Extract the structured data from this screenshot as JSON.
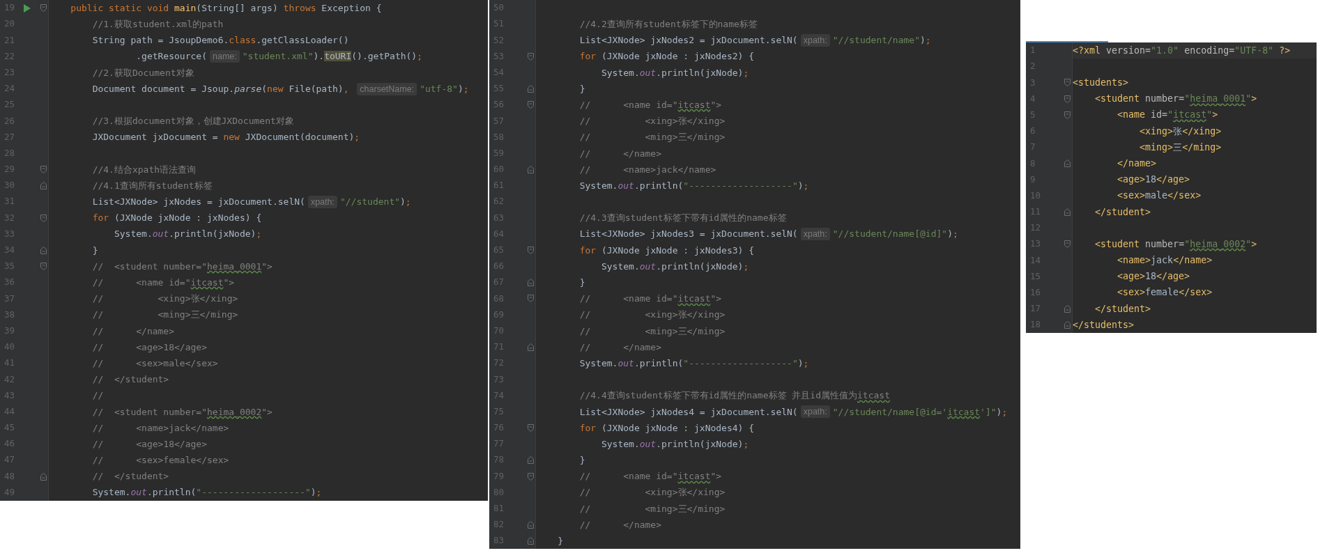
{
  "editors": [
    {
      "lines": [
        {
          "number": "19",
          "run": true,
          "fold": {
            "kind": "start"
          },
          "tokens": [
            {
              "text": "    public static void ",
              "kind": "keyword"
            },
            {
              "text": "main",
              "kind": "method"
            },
            {
              "text": "(String[] args) ",
              "kind": "plain"
            },
            {
              "text": "throws",
              "kind": "keyword"
            },
            {
              "text": " Exception {",
              "kind": "plain"
            }
          ]
        },
        {
          "number": "20",
          "tokens": [
            {
              "text": "        //1.获取student.xml的path",
              "kind": "comment"
            }
          ]
        },
        {
          "number": "21",
          "tokens": [
            {
              "text": "        String path = JsoupDemo6.",
              "kind": "plain"
            },
            {
              "text": "class",
              "kind": "keyword"
            },
            {
              "text": ".getClassLoader()",
              "kind": "plain"
            }
          ]
        },
        {
          "number": "22",
          "tokens": [
            {
              "text": "                .getResource(",
              "kind": "plain"
            },
            {
              "text": "name:",
              "kind": "hint"
            },
            {
              "text": "\"student.xml\"",
              "kind": "string"
            },
            {
              "text": ").",
              "kind": "plain"
            },
            {
              "text": "toURI",
              "kind": "highlight"
            },
            {
              "text": "().getPath()",
              "kind": "plain"
            },
            {
              "text": ";",
              "kind": "semi"
            }
          ]
        },
        {
          "number": "23",
          "tokens": [
            {
              "text": "        //2.获取Document对象",
              "kind": "comment"
            }
          ]
        },
        {
          "number": "24",
          "tokens": [
            {
              "text": "        Document document = Jsoup.",
              "kind": "plain"
            },
            {
              "text": "parse",
              "kind": "italic"
            },
            {
              "text": "(",
              "kind": "plain"
            },
            {
              "text": "new",
              "kind": "keyword"
            },
            {
              "text": " File(path)",
              "kind": "plain"
            },
            {
              "text": ", ",
              "kind": "semi"
            },
            {
              "text": "charsetName:",
              "kind": "hint"
            },
            {
              "text": "\"utf-8\"",
              "kind": "string"
            },
            {
              "text": ")",
              "kind": "plain"
            },
            {
              "text": ";",
              "kind": "semi"
            }
          ]
        },
        {
          "number": "25"
        },
        {
          "number": "26",
          "tokens": [
            {
              "text": "        //3.根据document对象，创建JXDocument对象",
              "kind": "comment"
            }
          ]
        },
        {
          "number": "27",
          "tokens": [
            {
              "text": "        JXDocument jxDocument = ",
              "kind": "plain"
            },
            {
              "text": "new",
              "kind": "keyword"
            },
            {
              "text": " JXDocument(document)",
              "kind": "plain"
            },
            {
              "text": ";",
              "kind": "semi"
            }
          ]
        },
        {
          "number": "28"
        },
        {
          "number": "29",
          "fold": {
            "kind": "start"
          },
          "tokens": [
            {
              "text": "        //4.结合xpath语法查询",
              "kind": "comment"
            }
          ]
        },
        {
          "number": "30",
          "fold": {
            "kind": "end"
          },
          "tokens": [
            {
              "text": "        //4.1查询所有student标签",
              "kind": "comment"
            }
          ]
        },
        {
          "number": "31",
          "tokens": [
            {
              "text": "        List<JXNode> jxNodes = jxDocument.selN(",
              "kind": "plain"
            },
            {
              "text": "xpath:",
              "kind": "hint"
            },
            {
              "text": "\"//student\"",
              "kind": "string"
            },
            {
              "text": ")",
              "kind": "plain"
            },
            {
              "text": ";",
              "kind": "semi"
            }
          ]
        },
        {
          "number": "32",
          "fold": {
            "kind": "start"
          },
          "tokens": [
            {
              "text": "        for",
              "kind": "keyword"
            },
            {
              "text": " (JXNode jxNode : jxNodes) {",
              "kind": "plain"
            }
          ]
        },
        {
          "number": "33",
          "tokens": [
            {
              "text": "            System.",
              "kind": "plain"
            },
            {
              "text": "out",
              "kind": "field"
            },
            {
              "text": ".println(jxNode)",
              "kind": "plain"
            },
            {
              "text": ";",
              "kind": "semi"
            }
          ]
        },
        {
          "number": "34",
          "fold": {
            "kind": "end"
          },
          "tokens": [
            {
              "text": "        }",
              "kind": "plain"
            }
          ]
        },
        {
          "number": "35",
          "fold": {
            "kind": "start"
          },
          "tokens": [
            {
              "text": "        //  <student number=\"",
              "kind": "comment"
            },
            {
              "text": "heima_0001",
              "kind": "typo_comment"
            },
            {
              "text": "\">",
              "kind": "comment"
            }
          ]
        },
        {
          "number": "36",
          "tokens": [
            {
              "text": "        //      <name id=\"",
              "kind": "comment"
            },
            {
              "text": "itcast",
              "kind": "typo_comment"
            },
            {
              "text": "\">",
              "kind": "comment"
            }
          ]
        },
        {
          "number": "37",
          "tokens": [
            {
              "text": "        //          <xing>张</xing>",
              "kind": "comment"
            }
          ]
        },
        {
          "number": "38",
          "tokens": [
            {
              "text": "        //          <ming>三</ming>",
              "kind": "comment"
            }
          ]
        },
        {
          "number": "39",
          "tokens": [
            {
              "text": "        //      </name>",
              "kind": "comment"
            }
          ]
        },
        {
          "number": "40",
          "tokens": [
            {
              "text": "        //      <age>18</age>",
              "kind": "comment"
            }
          ]
        },
        {
          "number": "41",
          "tokens": [
            {
              "text": "        //      <sex>male</sex>",
              "kind": "comment"
            }
          ]
        },
        {
          "number": "42",
          "tokens": [
            {
              "text": "        //  </student>",
              "kind": "comment"
            }
          ]
        },
        {
          "number": "43",
          "tokens": [
            {
              "text": "        //",
              "kind": "comment"
            }
          ]
        },
        {
          "number": "44",
          "tokens": [
            {
              "text": "        //  <student number=\"",
              "kind": "comment"
            },
            {
              "text": "heima_0002",
              "kind": "typo_comment"
            },
            {
              "text": "\">",
              "kind": "comment"
            }
          ]
        },
        {
          "number": "45",
          "tokens": [
            {
              "text": "        //      <name>jack</name>",
              "kind": "comment"
            }
          ]
        },
        {
          "number": "46",
          "tokens": [
            {
              "text": "        //      <age>18</age>",
              "kind": "comment"
            }
          ]
        },
        {
          "number": "47",
          "tokens": [
            {
              "text": "        //      <sex>female</sex>",
              "kind": "comment"
            }
          ]
        },
        {
          "number": "48",
          "fold": {
            "kind": "end"
          },
          "tokens": [
            {
              "text": "        //  </student>",
              "kind": "comment"
            }
          ]
        },
        {
          "number": "49",
          "tokens": [
            {
              "text": "        System.",
              "kind": "plain"
            },
            {
              "text": "out",
              "kind": "field"
            },
            {
              "text": ".println(",
              "kind": "plain"
            },
            {
              "text": "\"-------------------\"",
              "kind": "string"
            },
            {
              "text": ")",
              "kind": "plain"
            },
            {
              "text": ";",
              "kind": "semi"
            }
          ]
        }
      ]
    },
    {
      "lines": [
        {
          "number": "50"
        },
        {
          "number": "51",
          "tokens": [
            {
              "text": "        //4.2查询所有student标签下的name标签",
              "kind": "comment"
            }
          ]
        },
        {
          "number": "52",
          "tokens": [
            {
              "text": "        List<JXNode> jxNodes2 = jxDocument.selN(",
              "kind": "plain"
            },
            {
              "text": "xpath:",
              "kind": "hint"
            },
            {
              "text": "\"//student/name\"",
              "kind": "string"
            },
            {
              "text": ")",
              "kind": "plain"
            },
            {
              "text": ";",
              "kind": "semi"
            }
          ]
        },
        {
          "number": "53",
          "fold": {
            "kind": "start"
          },
          "tokens": [
            {
              "text": "        for",
              "kind": "keyword"
            },
            {
              "text": " (JXNode jxNode : jxNodes2) {",
              "kind": "plain"
            }
          ]
        },
        {
          "number": "54",
          "tokens": [
            {
              "text": "            System.",
              "kind": "plain"
            },
            {
              "text": "out",
              "kind": "field"
            },
            {
              "text": ".println(jxNode)",
              "kind": "plain"
            },
            {
              "text": ";",
              "kind": "semi"
            }
          ]
        },
        {
          "number": "55",
          "fold": {
            "kind": "end"
          },
          "tokens": [
            {
              "text": "        }",
              "kind": "plain"
            }
          ]
        },
        {
          "number": "56",
          "fold": {
            "kind": "start"
          },
          "tokens": [
            {
              "text": "        //      <name id=\"",
              "kind": "comment"
            },
            {
              "text": "itcast",
              "kind": "typo_comment"
            },
            {
              "text": "\">",
              "kind": "comment"
            }
          ]
        },
        {
          "number": "57",
          "tokens": [
            {
              "text": "        //          <xing>张</xing>",
              "kind": "comment"
            }
          ]
        },
        {
          "number": "58",
          "tokens": [
            {
              "text": "        //          <ming>三</ming>",
              "kind": "comment"
            }
          ]
        },
        {
          "number": "59",
          "tokens": [
            {
              "text": "        //      </name>",
              "kind": "comment"
            }
          ]
        },
        {
          "number": "60",
          "fold": {
            "kind": "end"
          },
          "tokens": [
            {
              "text": "        //      <name>jack</name>",
              "kind": "comment"
            }
          ]
        },
        {
          "number": "61",
          "tokens": [
            {
              "text": "        System.",
              "kind": "plain"
            },
            {
              "text": "out",
              "kind": "field"
            },
            {
              "text": ".println(",
              "kind": "plain"
            },
            {
              "text": "\"-------------------\"",
              "kind": "string"
            },
            {
              "text": ")",
              "kind": "plain"
            },
            {
              "text": ";",
              "kind": "semi"
            }
          ]
        },
        {
          "number": "62"
        },
        {
          "number": "63",
          "tokens": [
            {
              "text": "        //4.3查询student标签下带有id属性的name标签",
              "kind": "comment"
            }
          ]
        },
        {
          "number": "64",
          "tokens": [
            {
              "text": "        List<JXNode> jxNodes3 = jxDocument.selN(",
              "kind": "plain"
            },
            {
              "text": "xpath:",
              "kind": "hint"
            },
            {
              "text": "\"//student/name[@id]\"",
              "kind": "string"
            },
            {
              "text": ")",
              "kind": "plain"
            },
            {
              "text": ";",
              "kind": "semi"
            }
          ]
        },
        {
          "number": "65",
          "fold": {
            "kind": "start"
          },
          "tokens": [
            {
              "text": "        for",
              "kind": "keyword"
            },
            {
              "text": " (JXNode jxNode : jxNodes3) {",
              "kind": "plain"
            }
          ]
        },
        {
          "number": "66",
          "tokens": [
            {
              "text": "            System.",
              "kind": "plain"
            },
            {
              "text": "out",
              "kind": "field"
            },
            {
              "text": ".println(jxNode)",
              "kind": "plain"
            },
            {
              "text": ";",
              "kind": "semi"
            }
          ]
        },
        {
          "number": "67",
          "fold": {
            "kind": "end"
          },
          "tokens": [
            {
              "text": "        }",
              "kind": "plain"
            }
          ]
        },
        {
          "number": "68",
          "fold": {
            "kind": "start"
          },
          "tokens": [
            {
              "text": "        //      <name id=\"",
              "kind": "comment"
            },
            {
              "text": "itcast",
              "kind": "typo_comment"
            },
            {
              "text": "\">",
              "kind": "comment"
            }
          ]
        },
        {
          "number": "69",
          "tokens": [
            {
              "text": "        //          <xing>张</xing>",
              "kind": "comment"
            }
          ]
        },
        {
          "number": "70",
          "tokens": [
            {
              "text": "        //          <ming>三</ming>",
              "kind": "comment"
            }
          ]
        },
        {
          "number": "71",
          "fold": {
            "kind": "end"
          },
          "tokens": [
            {
              "text": "        //      </name>",
              "kind": "comment"
            }
          ]
        },
        {
          "number": "72",
          "tokens": [
            {
              "text": "        System.",
              "kind": "plain"
            },
            {
              "text": "out",
              "kind": "field"
            },
            {
              "text": ".println(",
              "kind": "plain"
            },
            {
              "text": "\"-------------------\"",
              "kind": "string"
            },
            {
              "text": ")",
              "kind": "plain"
            },
            {
              "text": ";",
              "kind": "semi"
            }
          ]
        },
        {
          "number": "73"
        },
        {
          "number": "74",
          "tokens": [
            {
              "text": "        //4.4查询student标签下带有id属性的name标签 并且id属性值为",
              "kind": "comment"
            },
            {
              "text": "itcast",
              "kind": "typo_comment"
            }
          ]
        },
        {
          "number": "75",
          "tokens": [
            {
              "text": "        List<JXNode> jxNodes4 = jxDocument.selN(",
              "kind": "plain"
            },
            {
              "text": "xpath:",
              "kind": "hint"
            },
            {
              "text": "\"//student/name[@id='",
              "kind": "string"
            },
            {
              "text": "itcast",
              "kind": "typo_string"
            },
            {
              "text": "']\"",
              "kind": "string"
            },
            {
              "text": ")",
              "kind": "plain"
            },
            {
              "text": ";",
              "kind": "semi"
            }
          ]
        },
        {
          "number": "76",
          "fold": {
            "kind": "start"
          },
          "tokens": [
            {
              "text": "        for",
              "kind": "keyword"
            },
            {
              "text": " (JXNode jxNode : jxNodes4) {",
              "kind": "plain"
            }
          ]
        },
        {
          "number": "77",
          "tokens": [
            {
              "text": "            System.",
              "kind": "plain"
            },
            {
              "text": "out",
              "kind": "field"
            },
            {
              "text": ".println(jxNode)",
              "kind": "plain"
            },
            {
              "text": ";",
              "kind": "semi"
            }
          ]
        },
        {
          "number": "78",
          "fold": {
            "kind": "end"
          },
          "tokens": [
            {
              "text": "        }",
              "kind": "plain"
            }
          ]
        },
        {
          "number": "79",
          "fold": {
            "kind": "start"
          },
          "tokens": [
            {
              "text": "        //      <name id=\"",
              "kind": "comment"
            },
            {
              "text": "itcast",
              "kind": "typo_comment"
            },
            {
              "text": "\">",
              "kind": "comment"
            }
          ]
        },
        {
          "number": "80",
          "tokens": [
            {
              "text": "        //          <xing>张</xing>",
              "kind": "comment"
            }
          ]
        },
        {
          "number": "81",
          "tokens": [
            {
              "text": "        //          <ming>三</ming>",
              "kind": "comment"
            }
          ]
        },
        {
          "number": "82",
          "fold": {
            "kind": "end"
          },
          "tokens": [
            {
              "text": "        //      </name>",
              "kind": "comment"
            }
          ]
        },
        {
          "number": "83",
          "fold": {
            "kind": "end"
          },
          "tokens": [
            {
              "text": "    }",
              "kind": "plain"
            }
          ]
        }
      ]
    },
    {
      "lines": [
        {
          "number": "1",
          "current": true,
          "tokens": [
            {
              "text": "<?xml ",
              "kind": "tag"
            },
            {
              "text": "version=",
              "kind": "attr"
            },
            {
              "text": "\"1.0\"",
              "kind": "string"
            },
            {
              "text": " encoding=",
              "kind": "attr"
            },
            {
              "text": "\"UTF-8\"",
              "kind": "string"
            },
            {
              "text": " ?>",
              "kind": "tag"
            }
          ]
        },
        {
          "number": "2"
        },
        {
          "number": "3",
          "fold": {
            "kind": "start"
          },
          "tokens": [
            {
              "text": "<students>",
              "kind": "tag"
            }
          ]
        },
        {
          "number": "4",
          "fold": {
            "kind": "start"
          },
          "tokens": [
            {
              "text": "    <student ",
              "kind": "tag"
            },
            {
              "text": "number=",
              "kind": "attr"
            },
            {
              "text": "\"",
              "kind": "string"
            },
            {
              "text": "heima_0001",
              "kind": "typo_string"
            },
            {
              "text": "\"",
              "kind": "string"
            },
            {
              "text": ">",
              "kind": "tag"
            }
          ]
        },
        {
          "number": "5",
          "fold": {
            "kind": "start"
          },
          "tokens": [
            {
              "text": "        <name ",
              "kind": "tag"
            },
            {
              "text": "id=",
              "kind": "attr"
            },
            {
              "text": "\"",
              "kind": "string"
            },
            {
              "text": "itcast",
              "kind": "typo_string"
            },
            {
              "text": "\"",
              "kind": "string"
            },
            {
              "text": ">",
              "kind": "tag"
            }
          ]
        },
        {
          "number": "6",
          "tokens": [
            {
              "text": "            <xing>",
              "kind": "tag"
            },
            {
              "text": "张",
              "kind": "plain"
            },
            {
              "text": "</xing>",
              "kind": "tag"
            }
          ]
        },
        {
          "number": "7",
          "tokens": [
            {
              "text": "            <ming>",
              "kind": "tag"
            },
            {
              "text": "三",
              "kind": "plain"
            },
            {
              "text": "</ming>",
              "kind": "tag"
            }
          ]
        },
        {
          "number": "8",
          "fold": {
            "kind": "end"
          },
          "tokens": [
            {
              "text": "        </name>",
              "kind": "tag"
            }
          ]
        },
        {
          "number": "9",
          "tokens": [
            {
              "text": "        <age>",
              "kind": "tag"
            },
            {
              "text": "18",
              "kind": "plain"
            },
            {
              "text": "</age>",
              "kind": "tag"
            }
          ]
        },
        {
          "number": "10",
          "tokens": [
            {
              "text": "        <sex>",
              "kind": "tag"
            },
            {
              "text": "male",
              "kind": "plain"
            },
            {
              "text": "</sex>",
              "kind": "tag"
            }
          ]
        },
        {
          "number": "11",
          "fold": {
            "kind": "end"
          },
          "tokens": [
            {
              "text": "    </student>",
              "kind": "tag"
            }
          ]
        },
        {
          "number": "12"
        },
        {
          "number": "13",
          "fold": {
            "kind": "start"
          },
          "tokens": [
            {
              "text": "    <student ",
              "kind": "tag"
            },
            {
              "text": "number=",
              "kind": "attr"
            },
            {
              "text": "\"",
              "kind": "string"
            },
            {
              "text": "heima_0002",
              "kind": "typo_string"
            },
            {
              "text": "\"",
              "kind": "string"
            },
            {
              "text": ">",
              "kind": "tag"
            }
          ]
        },
        {
          "number": "14",
          "tokens": [
            {
              "text": "        <name>",
              "kind": "tag"
            },
            {
              "text": "jack",
              "kind": "plain"
            },
            {
              "text": "</name>",
              "kind": "tag"
            }
          ]
        },
        {
          "number": "15",
          "tokens": [
            {
              "text": "        <age>",
              "kind": "tag"
            },
            {
              "text": "18",
              "kind": "plain"
            },
            {
              "text": "</age>",
              "kind": "tag"
            }
          ]
        },
        {
          "number": "16",
          "tokens": [
            {
              "text": "        <sex>",
              "kind": "tag"
            },
            {
              "text": "female",
              "kind": "plain"
            },
            {
              "text": "</sex>",
              "kind": "tag"
            }
          ]
        },
        {
          "number": "17",
          "fold": {
            "kind": "end"
          },
          "tokens": [
            {
              "text": "    </student>",
              "kind": "tag"
            }
          ]
        },
        {
          "number": "18",
          "fold": {
            "kind": "end"
          },
          "tokens": [
            {
              "text": "</students>",
              "kind": "tag"
            }
          ]
        }
      ]
    }
  ]
}
